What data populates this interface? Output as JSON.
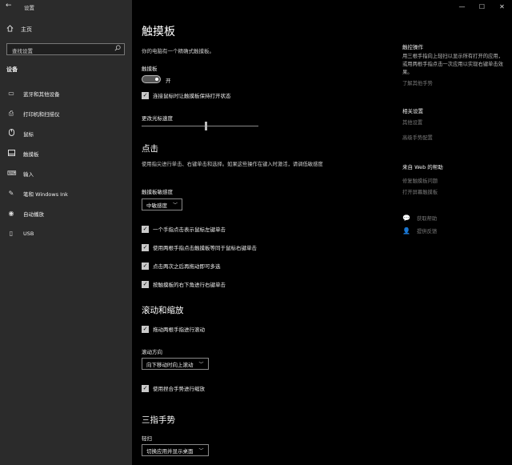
{
  "window": {
    "back_icon": "←",
    "title": "设置",
    "minimize": "—",
    "maximize": "☐",
    "close": "✕"
  },
  "sidebar": {
    "home_label": "主页",
    "search_placeholder": "查找设置",
    "section_title": "设备",
    "items": [
      {
        "label": "蓝牙和其他设备",
        "icon": "bluetooth-icon"
      },
      {
        "label": "打印机和扫描仪",
        "icon": "printer-icon"
      },
      {
        "label": "鼠标",
        "icon": "mouse-icon"
      },
      {
        "label": "触摸板",
        "icon": "touchpad-icon"
      },
      {
        "label": "输入",
        "icon": "keyboard-icon"
      },
      {
        "label": "笔和 Windows Ink",
        "icon": "pen-icon"
      },
      {
        "label": "自动播放",
        "icon": "autoplay-icon"
      },
      {
        "label": "USB",
        "icon": "usb-icon"
      }
    ]
  },
  "main": {
    "title": "触摸板",
    "subtitle": "你的电脑有一个精确式触摸板。",
    "touchpad_label": "触摸板",
    "toggle_state": "开",
    "keep_on_with_mouse": "连接鼠标时让触摸板保持打开状态",
    "cursor_speed_label": "更改光标速度",
    "cursor_speed_value": 0.55,
    "taps": {
      "heading": "点击",
      "description": "使用指尖进行单击、右键单击和选择。如果这些操作在键入时激活，请调低敏感度",
      "sensitivity_label": "触摸板敏感度",
      "sensitivity_value": "中敏感度",
      "options": [
        "一个手指点击表示鼠标左键单击",
        "使用两根手指点击触摸板等同于鼠标右键单击",
        "点击两次之后再拖动即可多选",
        "按触摸板的右下角进行右键单击"
      ]
    },
    "scroll": {
      "heading": "滚动和缩放",
      "drag_scroll": "拖动两根手指进行滚动",
      "direction_label": "滚动方向",
      "direction_value": "向下移动时向上滚动",
      "pinch_zoom": "使用捏合手势进行缩放"
    },
    "three_finger": {
      "heading": "三指手势",
      "swipe_label": "轻扫",
      "swipe_value": "切换应用并显示桌面"
    }
  },
  "right": {
    "gestures_heading": "触控操作",
    "gestures_text": "用三根手指向上轻扫以显示所有打开的应用，或用两根手指点击一次应用以实现右键单击效果。",
    "gestures_link": "了解其他手势",
    "related_heading": "相关设置",
    "related_links": [
      "其他设置",
      "高级手势配置"
    ],
    "web_help_heading": "来自 Web 的帮助",
    "web_help_links": [
      "修复触摸板问题",
      "打开屏幕触摸板"
    ],
    "get_help": "获取帮助",
    "feedback": "提供反馈"
  }
}
